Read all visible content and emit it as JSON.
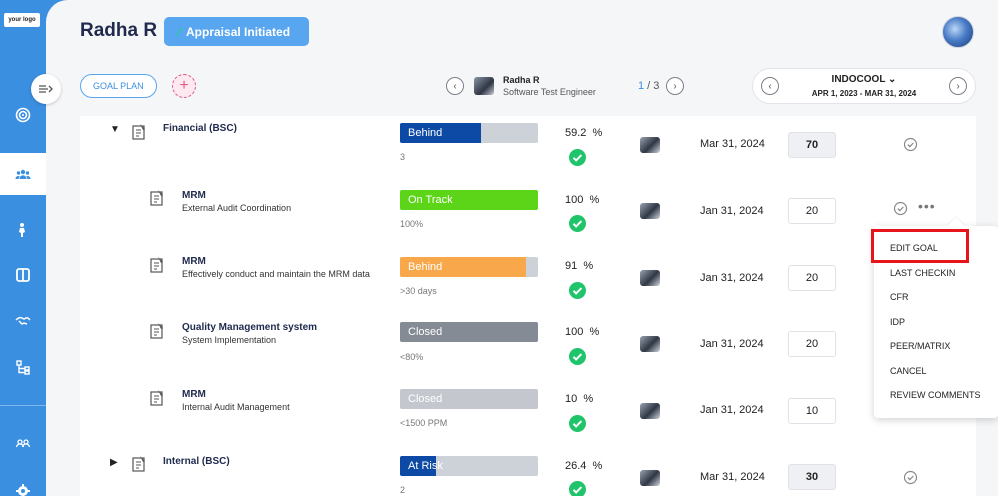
{
  "sidebar": {
    "logo_text": "your logo",
    "items": [
      {
        "icon": "target-icon"
      },
      {
        "icon": "team-icon",
        "active": true
      },
      {
        "icon": "person-icon"
      },
      {
        "icon": "book-icon"
      },
      {
        "icon": "handshake-icon"
      },
      {
        "icon": "org-chart-icon"
      },
      {
        "icon": "community-icon"
      },
      {
        "icon": "gear-icon"
      }
    ]
  },
  "header": {
    "employee_name": "Radha R",
    "status": "Appraisal Initiated",
    "goal_plan_label": "GOAL PLAN",
    "add_label": "+",
    "employee": {
      "name": "Radha R",
      "role": "Software Test Engineer"
    },
    "pager": {
      "current": "1",
      "separator": " / ",
      "total": "3"
    },
    "org": {
      "name": "INDOCOOL",
      "period": "APR 1, 2023 - MAR 31, 2024"
    }
  },
  "goals": [
    {
      "title": "Financial (BSC)",
      "subtitle": "",
      "expanded": true,
      "status": "Behind",
      "fill": 0.59,
      "color": "#0c4aa6",
      "note": "3",
      "percent": "59.2",
      "pct_sign": "%",
      "due": "Mar 31, 2024",
      "weight": "70",
      "group": true,
      "checkin": true
    },
    {
      "title": "MRM",
      "subtitle": "External Audit Coordination",
      "status": "On Track",
      "fill": 1.0,
      "color": "#5cd417",
      "note": "100%",
      "percent": "100",
      "pct_sign": "%",
      "due": "Jan 31, 2024",
      "weight": "20",
      "checkin": true,
      "more": true
    },
    {
      "title": "MRM",
      "subtitle": "Effectively conduct and maintain the MRM data",
      "status": "Behind",
      "fill": 0.91,
      "color": "#f8a84b",
      "note": ">30 days",
      "percent": "91",
      "pct_sign": "%",
      "due": "Jan 31, 2024",
      "weight": "20"
    },
    {
      "title": "Quality Management system",
      "subtitle": "System Implementation",
      "status": "Closed",
      "fill": 1.0,
      "color": "#858b94",
      "note": "<80%",
      "percent": "100",
      "pct_sign": "%",
      "due": "Jan 31, 2024",
      "weight": "20"
    },
    {
      "title": "MRM",
      "subtitle": "Internal Audit Management",
      "status": "Closed",
      "fill": 1.0,
      "color": "#c4c8ce",
      "note": "<1500 PPM",
      "percent": "10",
      "pct_sign": "%",
      "due": "Jan 31, 2024",
      "weight": "10"
    },
    {
      "title": "Internal (BSC)",
      "subtitle": "",
      "expanded": false,
      "status": "At Risk",
      "fill": 0.264,
      "color": "#0c4aa6",
      "note": "2",
      "percent": "26.4",
      "pct_sign": "%",
      "due": "Mar 31, 2024",
      "weight": "30",
      "group": true,
      "checkin": true
    }
  ],
  "menu": {
    "items": [
      "EDIT GOAL",
      "LAST CHECKIN",
      "CFR",
      "IDP",
      "PEER/MATRIX",
      "CANCEL",
      "REVIEW COMMENTS"
    ],
    "highlighted": "EDIT GOAL"
  }
}
